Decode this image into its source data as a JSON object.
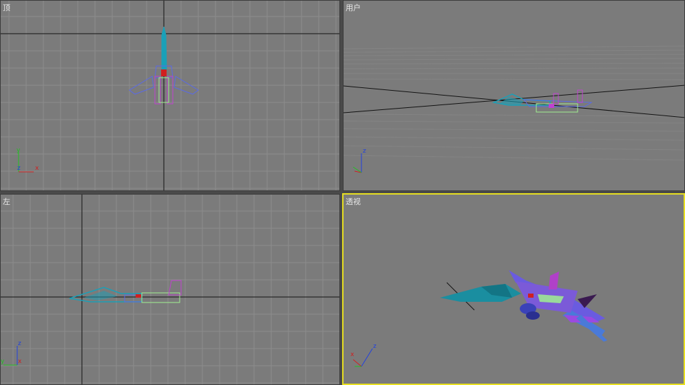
{
  "viewports": {
    "top": {
      "label": "顶",
      "axes": {
        "x": "x",
        "y": "y",
        "z": "z"
      }
    },
    "user": {
      "label": "用户",
      "axes": {
        "z": "z"
      }
    },
    "left": {
      "label": "左",
      "axes": {
        "y": "y",
        "z": "z",
        "x": "x"
      }
    },
    "perspective": {
      "label": "透视",
      "axes": {
        "x": "x",
        "z": "z"
      },
      "active": true
    }
  },
  "colors": {
    "viewport_bg": "#7b7b7b",
    "grid_line": "#8a8a8a",
    "active_border": "#e8e020",
    "axis_x": "#d02020",
    "axis_y": "#20c020",
    "axis_z": "#2040e0",
    "wire_teal": "#1aa0b8",
    "wire_purple": "#c040d0",
    "wire_blue": "#5a6ae8",
    "wire_green": "#a0f090"
  },
  "icons": {
    "axis_tripod": "axis-tripod-icon"
  }
}
